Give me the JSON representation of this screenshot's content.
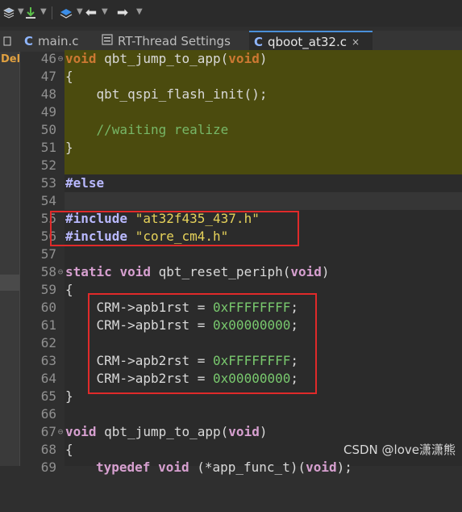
{
  "toolbar": {
    "icons": [
      "layers-icon",
      "download-icon",
      "stack-icon",
      "back-arrow-icon",
      "forward-arrow-icon"
    ]
  },
  "tabs": [
    {
      "label": "main.c",
      "icon": "C"
    },
    {
      "label": "RT-Thread Settings",
      "icon": "gear-icon"
    },
    {
      "label": "qboot_at32.c",
      "icon": "C",
      "close": "×"
    }
  ],
  "left_panel": {
    "label": "Del"
  },
  "code": {
    "l46": {
      "num": "46",
      "kw": "void",
      "rest": " qbt_jump_to_app(",
      "arg": "void",
      "close": ")"
    },
    "l47": {
      "num": "47",
      "text": "{"
    },
    "l48": {
      "num": "48",
      "text": "    qbt_qspi_flash_init();"
    },
    "l49": {
      "num": "49",
      "text": ""
    },
    "l50": {
      "num": "50",
      "text": "    //waiting realize"
    },
    "l51": {
      "num": "51",
      "text": "}"
    },
    "l52": {
      "num": "52",
      "text": ""
    },
    "l53": {
      "num": "53",
      "text": "#else"
    },
    "l54": {
      "num": "54",
      "text": ""
    },
    "l55": {
      "num": "55",
      "pp": "#include",
      "str": "\"at32f435_437.h\""
    },
    "l56": {
      "num": "56",
      "pp": "#include",
      "str": "\"core_cm4.h\""
    },
    "l57": {
      "num": "57",
      "text": ""
    },
    "l58": {
      "num": "58",
      "kw1": "static",
      "kw2": "void",
      "rest": " qbt_reset_periph(",
      "arg": "void",
      "close": ")"
    },
    "l59": {
      "num": "59",
      "text": "{"
    },
    "l60": {
      "num": "60",
      "lhs": "    CRM->apb1rst = ",
      "val": "0xFFFFFFFF",
      "end": ";"
    },
    "l61": {
      "num": "61",
      "lhs": "    CRM->apb1rst = ",
      "val": "0x00000000",
      "end": ";"
    },
    "l62": {
      "num": "62",
      "text": ""
    },
    "l63": {
      "num": "63",
      "lhs": "    CRM->apb2rst = ",
      "val": "0xFFFFFFFF",
      "end": ";"
    },
    "l64": {
      "num": "64",
      "lhs": "    CRM->apb2rst = ",
      "val": "0x00000000",
      "end": ";"
    },
    "l65": {
      "num": "65",
      "text": "}"
    },
    "l66": {
      "num": "66",
      "text": ""
    },
    "l67": {
      "num": "67",
      "kw": "void",
      "rest": " qbt_jump_to_app(",
      "arg": "void",
      "close": ")"
    },
    "l68": {
      "num": "68",
      "text": "{"
    },
    "l69": {
      "num": "69",
      "kw": "typedef void",
      "rest": " (*app_func_t)(",
      "arg": "void",
      "close": ");"
    }
  },
  "watermark": "CSDN @love潇潇熊"
}
